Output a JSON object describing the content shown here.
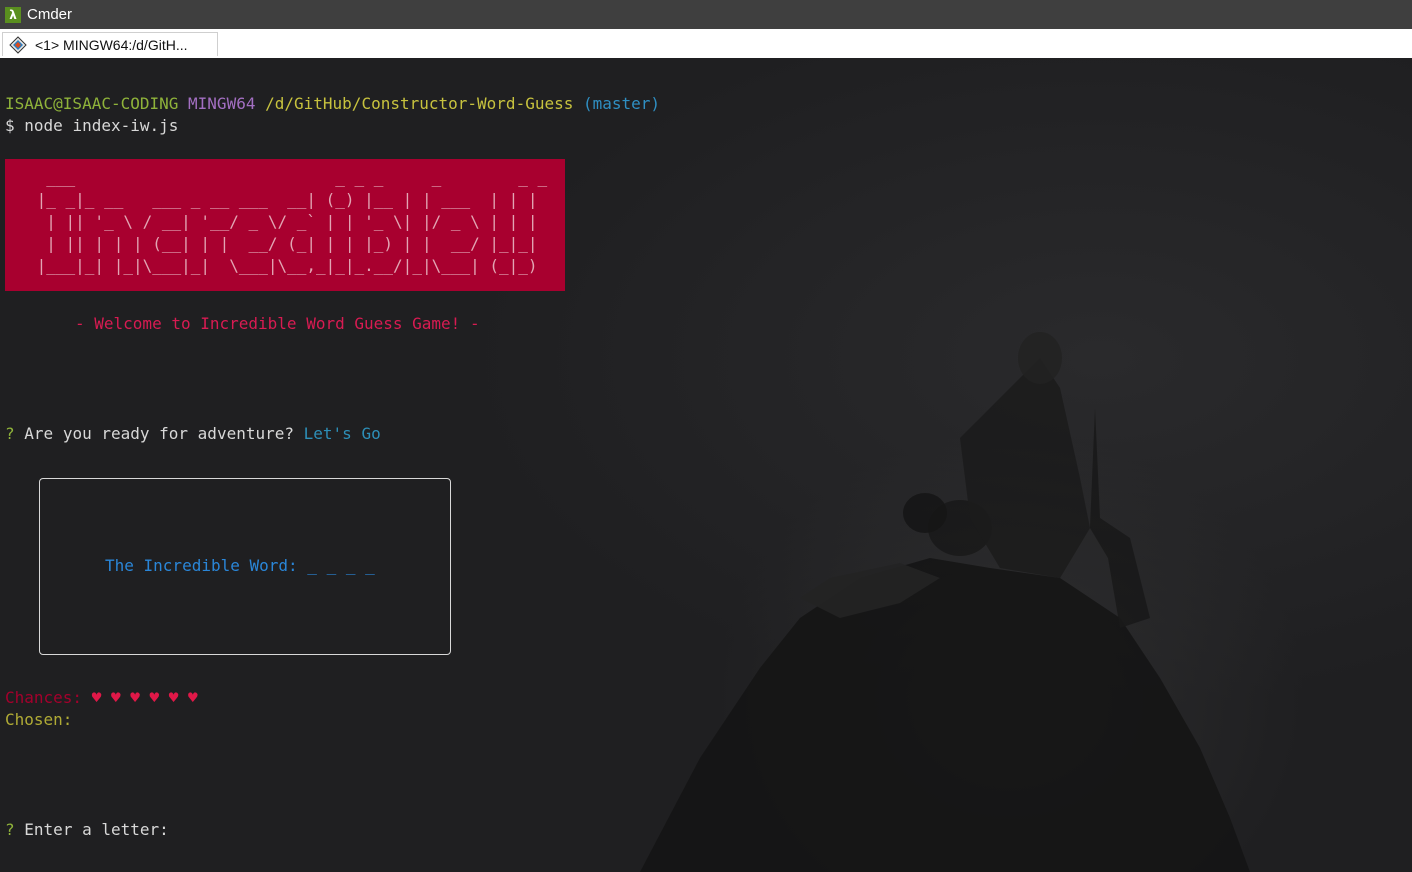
{
  "window": {
    "title": "Cmder"
  },
  "tab": {
    "label": "<1> MINGW64:/d/GitH..."
  },
  "prompt": {
    "user": "ISAAC@ISAAC-CODING",
    "env": "MINGW64",
    "path": "/d/GitHub/Constructor-Word-Guess",
    "branch": "(master)",
    "symbol": "$",
    "command": "node index-iw.js"
  },
  "banner": {
    "text": "  ___                           _ _ _     _        _ _ \n |_ _|_ __   ___ _ __ ___  __| (_) |__ | | ___  | | |\n  | || '_ \\ / __| '__/ _ \\/ _` | | '_ \\| |/ _ \\ | | |\n  | || | | | (__| | |  __/ (_| | | |_) | |  __/ |_|_|\n |___|_| |_|\\___|_|  \\___|\\__,_|_|_.__/|_|\\___| (_|_)"
  },
  "welcome": "- Welcome to Incredible Word Guess Game! -",
  "question1": {
    "mark": "?",
    "text": "Are you ready for adventure?",
    "answer": "Let's Go"
  },
  "word_box": {
    "label": "The Incredible Word:",
    "blanks": "_ _ _ _"
  },
  "chances": {
    "label": "Chances:",
    "hearts": "♥ ♥ ♥ ♥ ♥ ♥"
  },
  "chosen": {
    "label": "Chosen:"
  },
  "question2": {
    "mark": "?",
    "text": "Enter a letter:"
  },
  "colors": {
    "banner_bg": "#a8002f",
    "welcome": "#d81b52",
    "prompt_user": "#8fb33a",
    "prompt_path": "#c7c23e",
    "prompt_branch": "#2f8fc3",
    "word": "#2a86d8"
  }
}
